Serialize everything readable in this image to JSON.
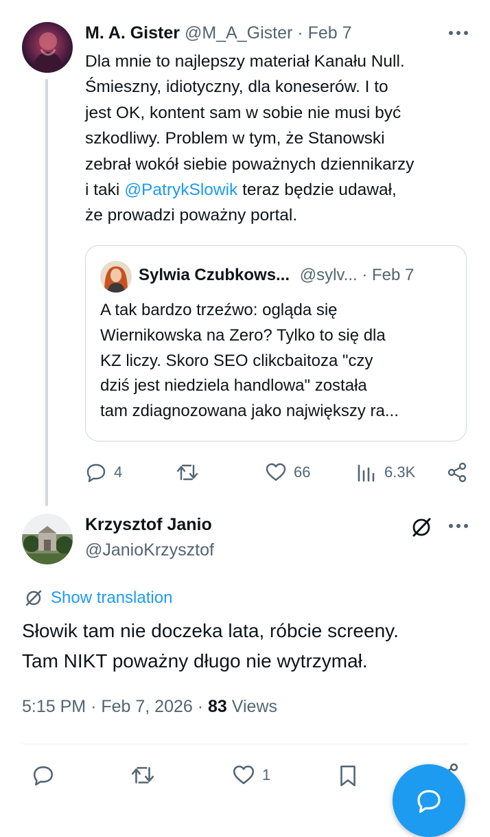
{
  "tweet": {
    "author_name": "M. A. Gister",
    "author_handle": "@M_A_Gister",
    "separator": "·",
    "date": "Feb 7",
    "body_lines": [
      "Dla mnie to najlepszy materiał Kanału Null.",
      "Śmieszny, idiotyczny, dla koneserów. I to",
      "jest OK, kontent sam w sobie nie musi być",
      "szkodliwy. Problem w tym, że Stanowski",
      "zebrał wokół siebie poważnych dziennikarzy"
    ],
    "line6_before": "i taki ",
    "mention": "@PatrykSlowik",
    "line6_after": " teraz będzie udawał,",
    "line7": "że prowadzi poważny portal.",
    "quote": {
      "author_name": "Sylwia Czubkows...",
      "author_handle": "@sylv...",
      "separator": "·",
      "date": "Feb 7",
      "body_lines": [
        "A tak bardzo trzeźwo: ogląda się",
        "Wiernikowska na Zero? Tylko to się dla",
        "KZ liczy. Skoro SEO clikcbaitoza \"czy",
        "dziś jest niedziela handlowa\" została",
        "tam zdiagnozowana jako największy ra..."
      ]
    },
    "actions": {
      "replies": "4",
      "reposts": "",
      "likes": "66",
      "views": "6.3K"
    }
  },
  "reply": {
    "author_name": "Krzysztof Janio",
    "author_handle": "@JanioKrzysztof",
    "show_translation": "Show translation",
    "body_lines": [
      "Słowik tam nie doczeka lata, róbcie screeny.",
      "Tam NIKT poważny długo nie wytrzymał."
    ],
    "time": "5:15 PM",
    "separator": "·",
    "date": "Feb 7, 2026",
    "views_count": "83",
    "views_label": "Views",
    "actions": {
      "likes": "1"
    }
  },
  "colors": {
    "accent": "#1d9bf0",
    "muted_text": "#536471",
    "border": "#cfd9de"
  },
  "icons": [
    "more-icon",
    "reply-icon",
    "repost-icon",
    "like-icon",
    "views-icon",
    "share-icon",
    "grok-icon",
    "translate-icon",
    "bookmark-icon",
    "compose-icon"
  ]
}
